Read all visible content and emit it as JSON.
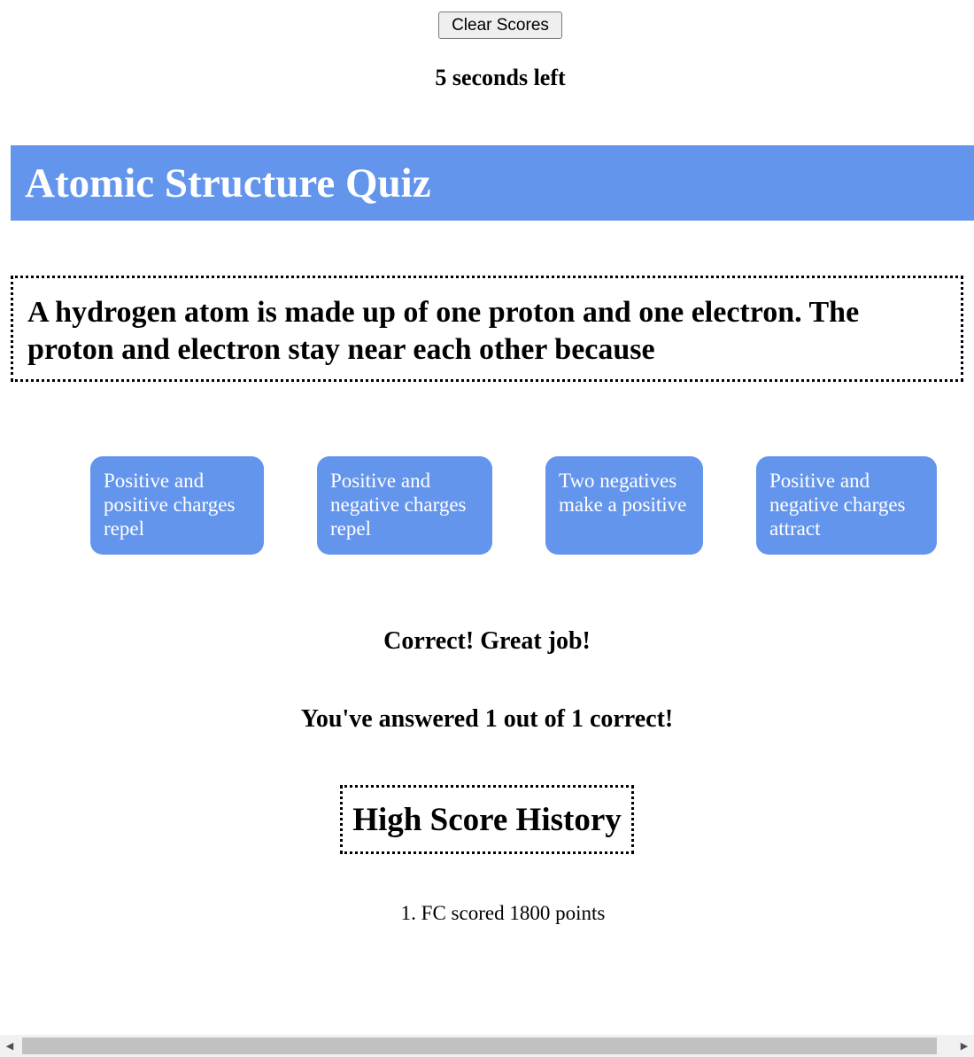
{
  "controls": {
    "clear_label": "Clear Scores"
  },
  "timer": {
    "text": "5 seconds left"
  },
  "header": {
    "title": "Atomic Structure Quiz",
    "background": "#6495ed"
  },
  "question": {
    "text": "A hydrogen atom is made up of one proton and one electron. The proton and electron stay near each other because"
  },
  "answers": [
    {
      "label": "Positive and positive charges repel"
    },
    {
      "label": "Positive and negative charges repel"
    },
    {
      "label": "Two negatives make a positive"
    },
    {
      "label": "Positive and negative charges attract"
    }
  ],
  "feedback": {
    "text": "Correct! Great job!"
  },
  "tally": {
    "text": "You've answered 1 out of 1 correct!"
  },
  "high_scores": {
    "title": "High Score History",
    "entries": [
      {
        "text": "1. FC scored 1800 points"
      }
    ]
  },
  "scrollbar": {
    "left_arrow": "◀",
    "right_arrow": "▶"
  }
}
